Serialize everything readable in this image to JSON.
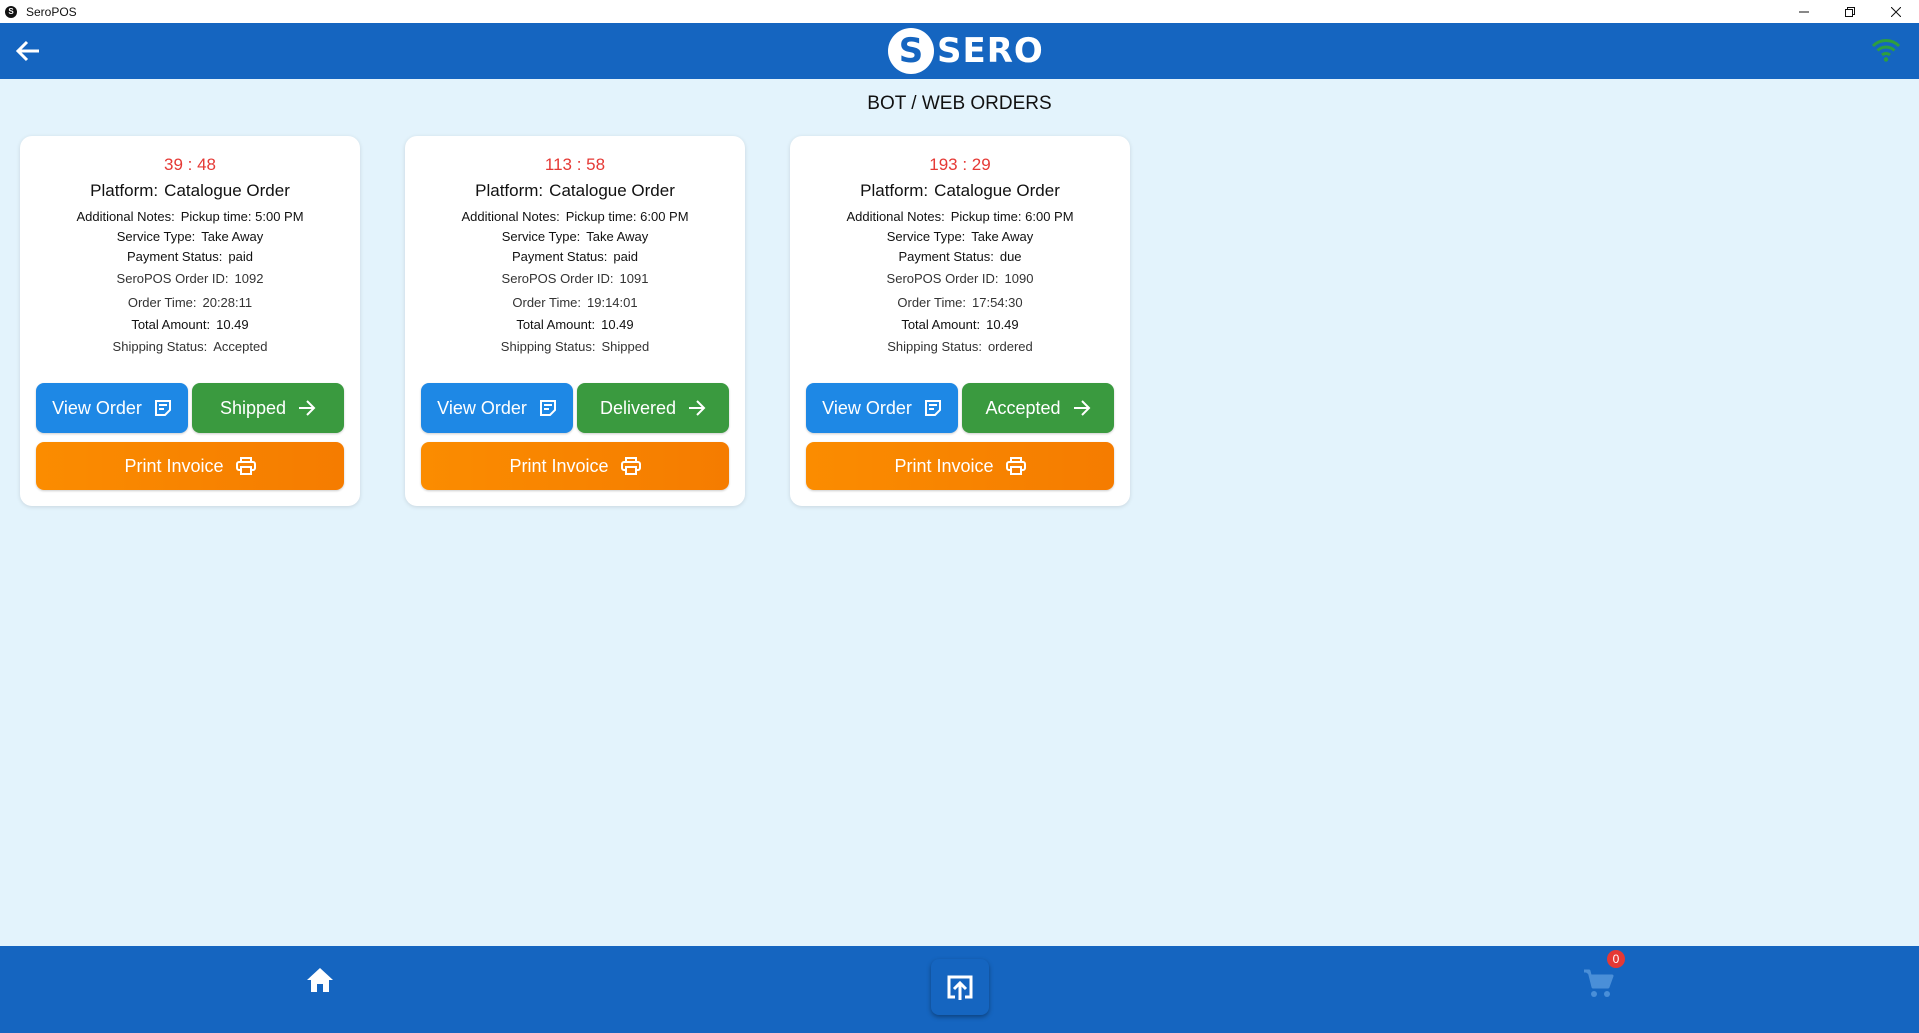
{
  "window": {
    "title": "SeroPOS"
  },
  "header": {
    "logo_text": "SERO",
    "logo_mark": "S",
    "wifi_color": "#2e9e3e"
  },
  "page": {
    "title": "BOT / WEB ORDERS"
  },
  "labels": {
    "platform": "Platform:",
    "notes": "Additional Notes:",
    "service": "Service Type:",
    "payment": "Payment Status:",
    "order_id": "SeroPOS Order ID:",
    "order_time": "Order Time:",
    "total": "Total Amount:",
    "shipping": "Shipping Status:",
    "view_order": "View Order",
    "print_invoice": "Print Invoice"
  },
  "orders": [
    {
      "timer": "39 : 48",
      "platform": "Catalogue Order",
      "notes": "Pickup time: 5:00 PM",
      "service": "Take Away",
      "payment": "paid",
      "order_id": "1092",
      "order_time": "20:28:11",
      "total": "10.49",
      "shipping": "Accepted",
      "next_action": "Shipped"
    },
    {
      "timer": "113 : 58",
      "platform": "Catalogue Order",
      "notes": "Pickup time: 6:00 PM",
      "service": "Take Away",
      "payment": "paid",
      "order_id": "1091",
      "order_time": "19:14:01",
      "total": "10.49",
      "shipping": "Shipped",
      "next_action": "Delivered"
    },
    {
      "timer": "193 : 29",
      "platform": "Catalogue Order",
      "notes": "Pickup time: 6:00 PM",
      "service": "Take Away",
      "payment": "due",
      "order_id": "1090",
      "order_time": "17:54:30",
      "total": "10.49",
      "shipping": "ordered",
      "next_action": "Accepted"
    }
  ],
  "bottom_nav": {
    "cart_count": "0"
  },
  "colors": {
    "primary": "#1565c0",
    "view": "#1e88e5",
    "next": "#3a9a3f",
    "print": "#fb8c00",
    "timer": "#e53935",
    "background": "#e3f3fc"
  }
}
